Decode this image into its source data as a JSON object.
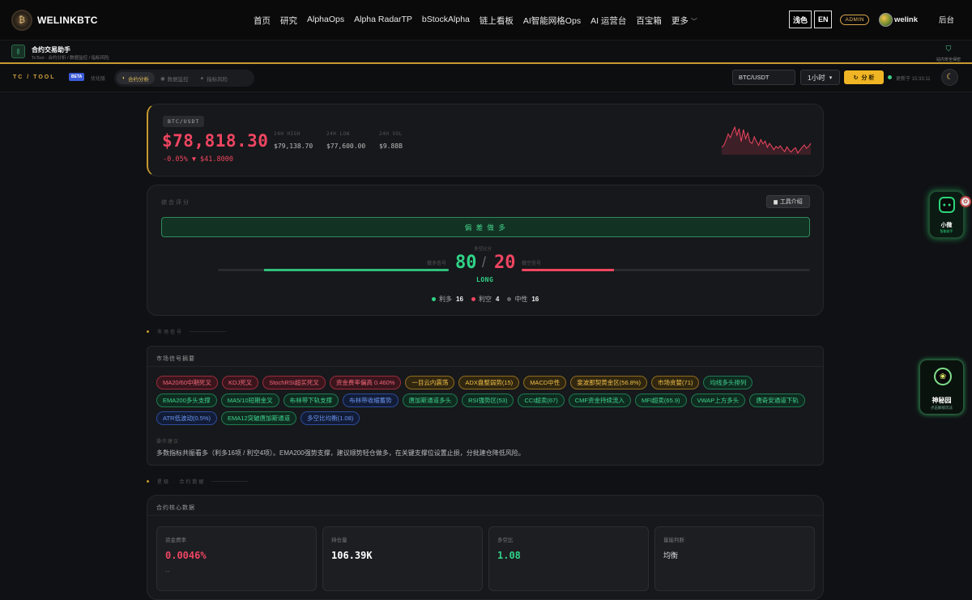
{
  "nav": {
    "logo_text": "WELINKBTC",
    "items": [
      "首页",
      "研究",
      "AlphaOps",
      "Alpha RadarTP",
      "bStockAlpha",
      "链上看板",
      "AI智能网格Ops",
      "AI 运营台",
      "百宝箱",
      "更多"
    ],
    "theme_label": "浅色",
    "lang_label": "EN",
    "admin_label": "ADMIN",
    "user_name": "welink",
    "backend_label": "后台"
  },
  "subheader": {
    "title": "合约交易助手",
    "breadcrumb": "TcTool · 合约分析 / 数据监控 / 指标风险",
    "secure_text": "站内安全保密"
  },
  "toolbar": {
    "brand": "TC / TOOL",
    "beta": "BETA",
    "youhua": "优化版",
    "tabs": [
      "合约分析",
      "数据监控",
      "指标风险"
    ],
    "pair_value": "BTC/USDT",
    "timeframe": "1小时",
    "analyze_label": "分 析",
    "updated_text": "更新于 15:33:11"
  },
  "price": {
    "pair": "BTC/USDT",
    "value": "$78,818.30",
    "change": "-0.05% ▼ $41.8000",
    "high_label": "24H HIGH",
    "high": "$79,138.70",
    "low_label": "24H LOW",
    "low": "$77,600.00",
    "vol_label": "24H VOL",
    "vol": "$9.88B",
    "sparkline": [
      70,
      66,
      55,
      42,
      50,
      38,
      28,
      45,
      31,
      58,
      33,
      52,
      40,
      59,
      62,
      48,
      58,
      66,
      54,
      63,
      57,
      70,
      62,
      68,
      75,
      68,
      72,
      67,
      74,
      79,
      69,
      76,
      80,
      74,
      71,
      82,
      76,
      70,
      65,
      72,
      68,
      62
    ]
  },
  "score": {
    "section_label": "综合评分",
    "intro_label": "工具介绍",
    "bias": "偏 差 做 多",
    "caption": "多空比分",
    "long_score": "80",
    "short_score": "20",
    "long_label": "做多信号",
    "short_label": "做空信号",
    "long_tag": "LONG",
    "long_fraction": 0.8,
    "short_fraction": 0.2,
    "bull_label": "利多",
    "bull_count": "16",
    "bear_label": "利空",
    "bear_count": "4",
    "neutral_label": "中性",
    "neutral_count": "16"
  },
  "section_market": "市场信号",
  "signals": {
    "title": "市场信号摘要",
    "chips": [
      {
        "label": "MA20/60中期死叉",
        "tone": "red"
      },
      {
        "label": "KDJ死叉",
        "tone": "red"
      },
      {
        "label": "StochRSI超买死叉",
        "tone": "red"
      },
      {
        "label": "资金费率偏高 0.460%",
        "tone": "red"
      },
      {
        "label": "一目云内震荡",
        "tone": "yellow"
      },
      {
        "label": "ADX盘整弱势(15)",
        "tone": "yellow"
      },
      {
        "label": "MACD中性",
        "tone": "yellow"
      },
      {
        "label": "斐波那契黄金区(56.8%)",
        "tone": "yellow"
      },
      {
        "label": "市场贪婪(71)",
        "tone": "yellow"
      },
      {
        "label": "均线多头排列",
        "tone": "green"
      },
      {
        "label": "EMA200多头支撑",
        "tone": "green"
      },
      {
        "label": "MA5/10短期金叉",
        "tone": "green"
      },
      {
        "label": "布林带下轨支撑",
        "tone": "green"
      },
      {
        "label": "布林带收缩蓄势",
        "tone": "blue"
      },
      {
        "label": "唐加斯通道多头",
        "tone": "green"
      },
      {
        "label": "RSI强势区(53)",
        "tone": "green"
      },
      {
        "label": "CCI超卖(67)",
        "tone": "green"
      },
      {
        "label": "CMF资金持续流入",
        "tone": "green"
      },
      {
        "label": "MFI超卖(65.9)",
        "tone": "green"
      },
      {
        "label": "VWAP上方多头",
        "tone": "green"
      },
      {
        "label": "唐奇安通道下轨",
        "tone": "green"
      },
      {
        "label": "ATR低波动(0.5%)",
        "tone": "blue"
      },
      {
        "label": "EMA12突破唐加斯通道",
        "tone": "green"
      },
      {
        "label": "多空比均衡(1.08)",
        "tone": "blue"
      }
    ],
    "op_label": "操作建议",
    "op_text": "多数指标共振看多（利多16项 / 利空4项）。EMA200强势支撑，建议顺势轻仓做多，在关键支撑位设置止损，分批建仓降低风险。"
  },
  "section_contract": "星級 · 合约数据",
  "core": {
    "title": "合约核心数据",
    "metrics": [
      {
        "label": "资金费率",
        "value": "0.0046%",
        "color": "#ef4561",
        "sub": "--"
      },
      {
        "label": "持仓量",
        "value": "106.39K",
        "color": "#ffffff",
        "sub": ""
      },
      {
        "label": "多空比",
        "value": "1.08",
        "color": "#2fd387",
        "sub": ""
      },
      {
        "label": "量能判断",
        "value": "均衡",
        "color": "#dddddd",
        "sub": ""
      }
    ]
  },
  "widgets": {
    "xw_name": "小微",
    "xw_sub": "智能助手",
    "sm_name": "神秘园",
    "sm_sub": "点击解锁玩法"
  }
}
